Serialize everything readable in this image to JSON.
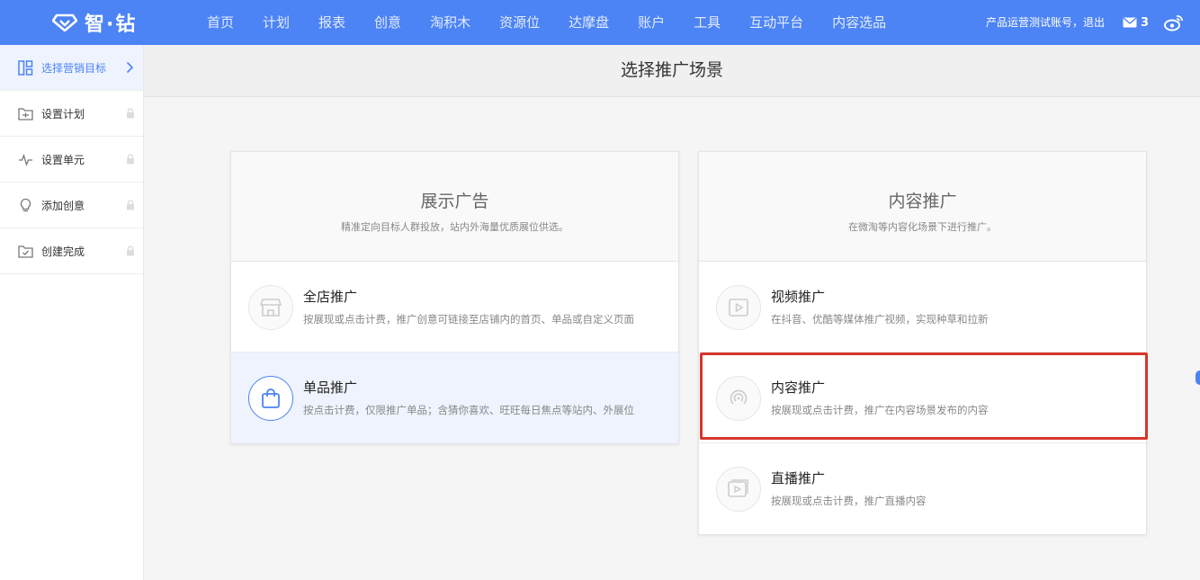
{
  "brand": {
    "logo_text": "智·钻"
  },
  "nav": {
    "items": [
      "首页",
      "计划",
      "报表",
      "创意",
      "淘积木",
      "资源位",
      "达摩盘",
      "账户",
      "工具",
      "互动平台",
      "内容选品"
    ]
  },
  "account": {
    "label": "产品运营测试账号，退出"
  },
  "messages": {
    "count": "3"
  },
  "sidebar": {
    "items": [
      {
        "label": "选择营销目标",
        "icon": "grid-icon",
        "state": "active"
      },
      {
        "label": "设置计划",
        "icon": "folder-icon",
        "state": "locked"
      },
      {
        "label": "设置单元",
        "icon": "pulse-icon",
        "state": "locked"
      },
      {
        "label": "添加创意",
        "icon": "lightbulb-icon",
        "state": "locked"
      },
      {
        "label": "创建完成",
        "icon": "folder-check-icon",
        "state": "locked"
      }
    ]
  },
  "main": {
    "title": "选择推广场景"
  },
  "cards": [
    {
      "title": "展示广告",
      "subtitle": "精准定向目标人群投放，站内外海量优质展位供选。",
      "options": [
        {
          "name": "全店推广",
          "desc": "按展现或点击计费，推广创意可链接至店铺内的首页、单品或自定义页面",
          "icon": "store-icon"
        },
        {
          "name": "单品推广",
          "desc": "按点击计费，仅限推广单品；含猜你喜欢、旺旺每日焦点等站内、外展位",
          "icon": "shopping-bag-icon",
          "selected": true
        }
      ]
    },
    {
      "title": "内容推广",
      "subtitle": "在微淘等内容化场景下进行推广。",
      "options": [
        {
          "name": "视频推广",
          "desc": "在抖音、优酷等媒体推广视频，实现种草和拉新",
          "icon": "video-play-icon"
        },
        {
          "name": "内容推广",
          "desc": "按展现或点击计费，推广在内容场景发布的内容",
          "icon": "broadcast-icon"
        },
        {
          "name": "直播推广",
          "desc": "按展现或点击计费，推广直播内容",
          "icon": "live-stream-icon"
        }
      ]
    }
  ],
  "colors": {
    "primary": "#4c83f5",
    "highlight": "#d6362a",
    "selected_bg": "#eef3fd"
  }
}
